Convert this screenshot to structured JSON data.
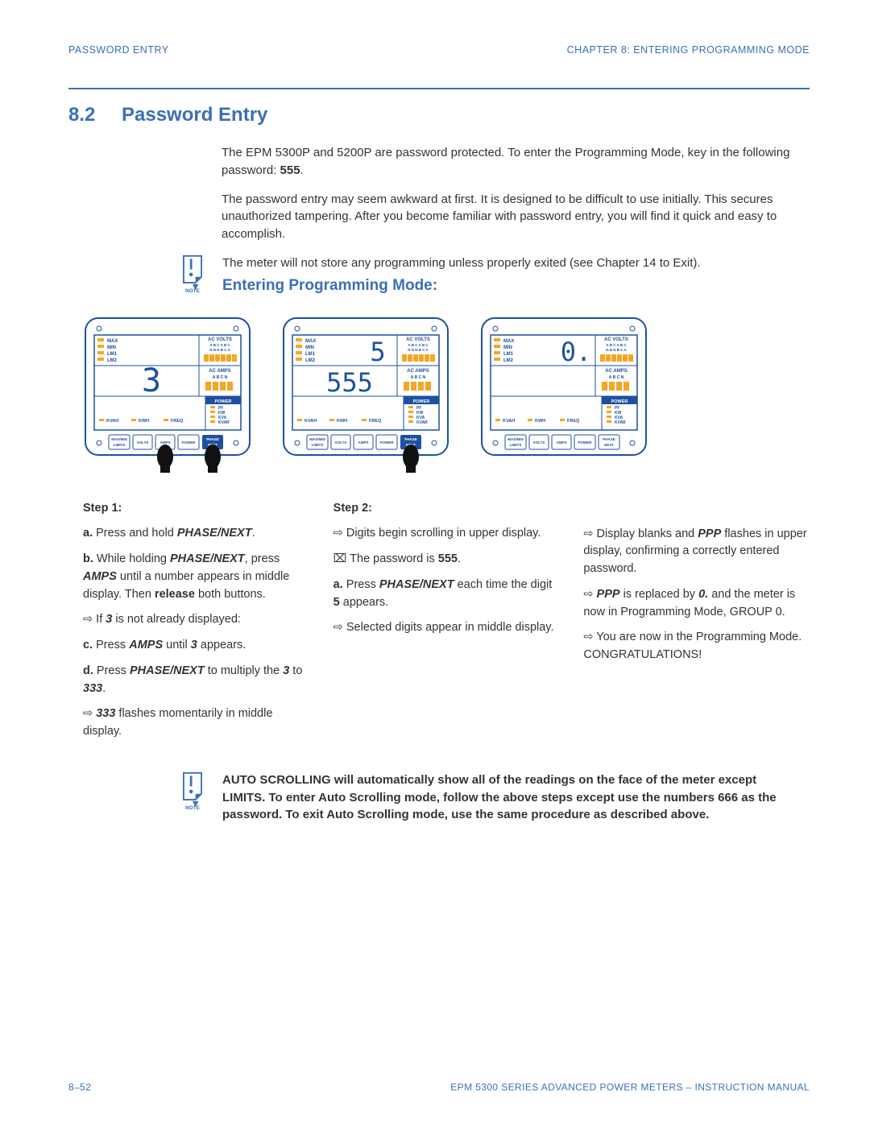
{
  "header": {
    "left": "PASSWORD ENTRY",
    "right": "CHAPTER 8: ENTERING PROGRAMMING MODE"
  },
  "section": {
    "num": "8.2",
    "title": "Password Entry"
  },
  "intro": {
    "p1a": "The EPM 5300P and 5200P are password protected.  To enter the Programming Mode, key in the following password: ",
    "p1b": "555",
    "p1c": ".",
    "p2": "The password entry may seem awkward at first.  It is designed to be difficult to use initially. This secures unauthorized tampering.  After you become familiar with password entry, you will find it quick and easy to accomplish."
  },
  "note1": "The meter will not store any programming unless properly exited (see Chapter 14 to Exit).",
  "sub_title": "Entering Programming Mode:",
  "meter_labels": {
    "max": "MAX",
    "min": "MIN",
    "lm1": "LM1",
    "lm2": "LM2",
    "acvolts": "AC VOLTS",
    "abcabc": "A  B  C  A  B  C",
    "nnnbca": "N  N  N  B  C  A",
    "acamps": "AC AMPS",
    "abcn": "A  B  C  N",
    "power": "POWER",
    "pf": "PF",
    "kw": "KW",
    "kva": "KVA",
    "kvar": "KVAR",
    "kvah": "KVAH",
    "kwh": "KWH",
    "freq": "FREQ",
    "btn_maxmin": "MAX/MIN",
    "btn_limits": "LIMITS",
    "btn_volts": "VOLTS",
    "btn_amps": "AMPS",
    "btn_power": "POWER",
    "btn_phase": "PHASE",
    "btn_next": "NEXT",
    "digit1": "3",
    "digit2_top": "5",
    "digit2_mid": "555",
    "digit3_top": "0."
  },
  "steps": {
    "s1": {
      "label": "Step 1:",
      "a_pre": "a.",
      "a_text": " Press and hold ",
      "a_btn": "PHASE/NEXT",
      "a_post": ".",
      "b_pre": "b.",
      "b_t1": " While holding ",
      "b_btn1": "PHASE/NEXT",
      "b_t2": ",  press ",
      "b_btn2": "AMPS",
      "b_t3": " until a number appears in middle display. Then ",
      "b_rel": "release",
      "b_t4": " both buttons.",
      "arr1": "⇨ If ",
      "arr1_3": "3",
      "arr1_post": " is not already displayed:",
      "c_pre": "c.",
      "c_t1": " Press ",
      "c_btn": "AMPS",
      "c_t2": " until ",
      "c_3": "3",
      "c_t3": " appears.",
      "d_pre": "d.",
      "d_t1": " Press ",
      "d_btn": "PHASE/NEXT",
      "d_t2": " to multiply the ",
      "d_3": "3",
      "d_t3": " to ",
      "d_333": "333",
      "d_t4": ".",
      "arr2": "⇨   ",
      "arr2_333": "333",
      "arr2_post": " flashes momentarily in middle display."
    },
    "s2": {
      "label": "Step 2:",
      "l1": "⇨ Digits begin scrolling in upper display.",
      "l2_pre": "⌧ The password is ",
      "l2_b": "555",
      "l2_post": ".",
      "a_pre": "a.",
      "a_t1": " Press ",
      "a_btn": "PHASE/NEXT",
      "a_t2": " each time the digit ",
      "a_5": "5",
      "a_t3": " appears.",
      "l3": "⇨ Selected digits appear in middle display."
    },
    "s3": {
      "l1_pre": "⇨ Display blanks and ",
      "l1_ppp": "PPP",
      "l1_post": " flashes in upper display, confirming a correctly entered password.",
      "l2_pre": "⇨ ",
      "l2_ppp": "PPP",
      "l2_t1": " is replaced by ",
      "l2_0": "0.",
      "l2_t2": " and the meter is now in Programming Mode, GROUP 0.",
      "l3": "⇨ You are now in the Programming Mode. CONGRATULATIONS!"
    }
  },
  "note2": "AUTO SCROLLING will automatically show all of the readings on the face of the meter except LIMITS.  To enter Auto Scrolling mode, follow the above steps except use the numbers 666 as the password.  To exit Auto Scrolling mode, use the same procedure as described above.",
  "footer": {
    "left": "8–52",
    "right": "EPM 5300 SERIES ADVANCED POWER METERS – INSTRUCTION MANUAL"
  },
  "note_label": "NOTE"
}
